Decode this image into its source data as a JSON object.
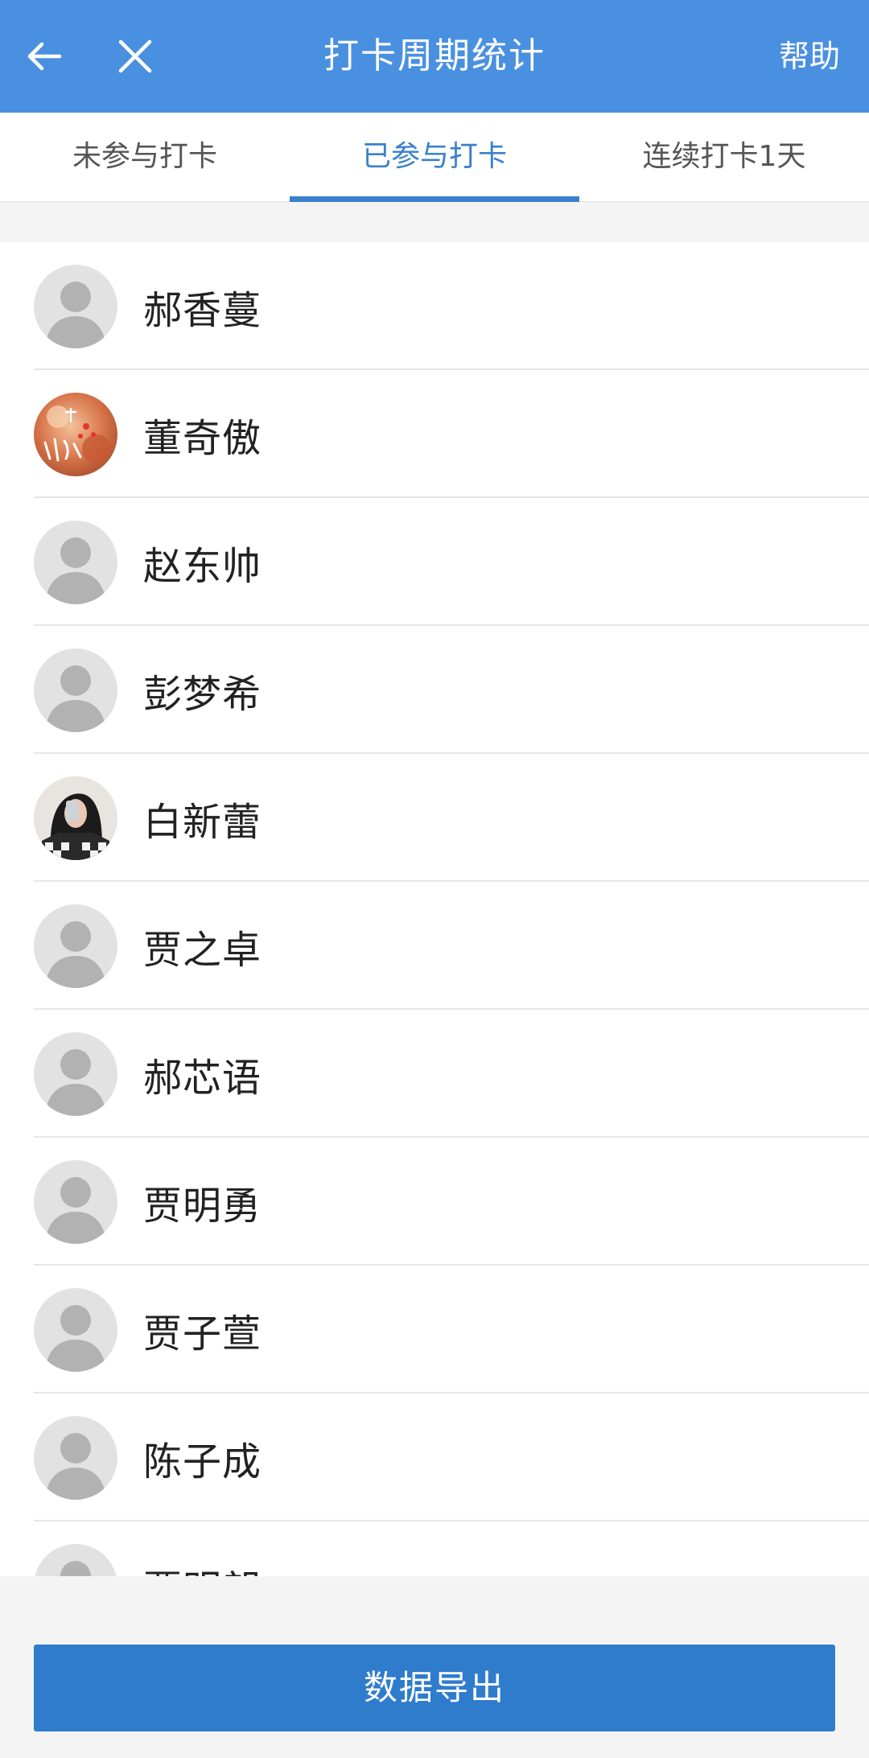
{
  "header": {
    "title": "打卡周期统计",
    "help_label": "帮助",
    "back_icon": "back-arrow-icon",
    "close_icon": "close-icon"
  },
  "tabs": [
    {
      "label": "未参与打卡",
      "active": false
    },
    {
      "label": "已参与打卡",
      "active": true
    },
    {
      "label": "连续打卡1天",
      "active": false
    }
  ],
  "members": [
    {
      "name": "郝香蔓",
      "avatar": "default"
    },
    {
      "name": "董奇傲",
      "avatar": "photo-flowers"
    },
    {
      "name": "赵东帅",
      "avatar": "default"
    },
    {
      "name": "彭梦希",
      "avatar": "default"
    },
    {
      "name": "白新蕾",
      "avatar": "photo-selfie"
    },
    {
      "name": "贾之卓",
      "avatar": "default"
    },
    {
      "name": "郝芯语",
      "avatar": "default"
    },
    {
      "name": "贾明勇",
      "avatar": "default"
    },
    {
      "name": "贾子萱",
      "avatar": "default"
    },
    {
      "name": "陈子成",
      "avatar": "default"
    },
    {
      "name": "贾明朗",
      "avatar": "default"
    }
  ],
  "footer": {
    "export_label": "数据导出"
  },
  "colors": {
    "header_bg": "#4a90e0",
    "accent": "#3a80cc",
    "button_bg": "#2f7ccd"
  }
}
